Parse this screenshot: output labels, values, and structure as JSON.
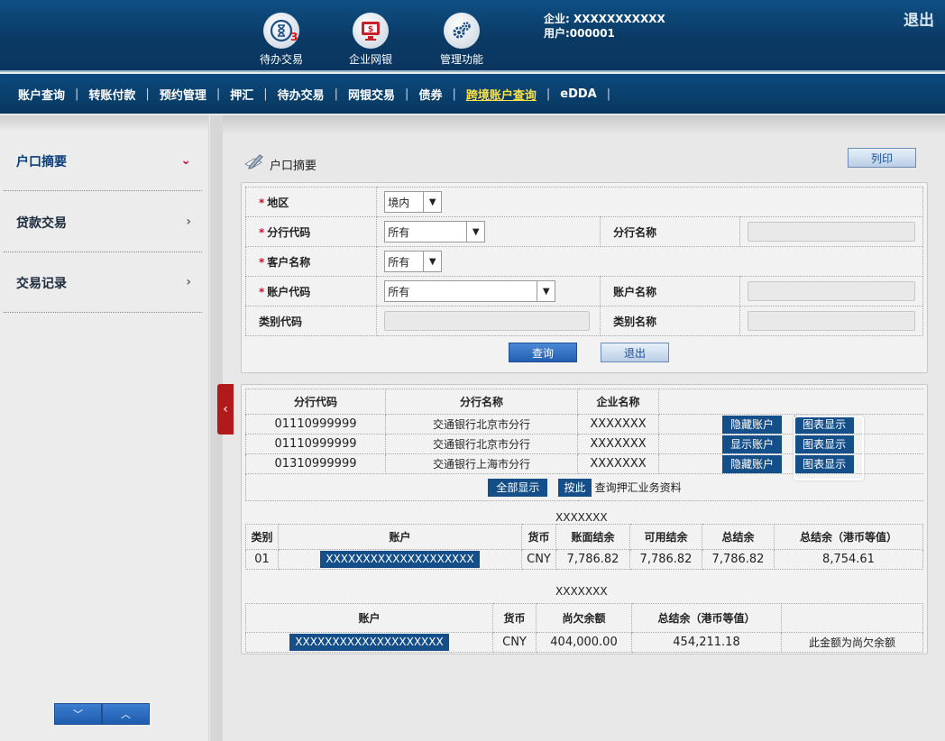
{
  "header": {
    "icons": [
      {
        "label": "待办交易",
        "icon": "hourglass-clock-icon",
        "badge": "3"
      },
      {
        "label": "企业网银",
        "icon": "monitor-dollar-icon"
      },
      {
        "label": "管理功能",
        "icon": "gears-icon"
      }
    ],
    "company": "企业: XXXXXXXXXXX",
    "user": "用户:000001",
    "logout": "退出"
  },
  "nav": {
    "items": [
      "账户查询",
      "转账付款",
      "预约管理",
      "押汇",
      "待办交易",
      "网银交易",
      "债券",
      "跨境账户查询",
      "eDDA"
    ],
    "active": "跨境账户查询",
    "separator": "|"
  },
  "sidebar": {
    "items": [
      {
        "label": "户口摘要",
        "chevron": "⌄"
      },
      {
        "label": "贷款交易",
        "chevron": "›"
      },
      {
        "label": "交易记录",
        "chevron": "›"
      }
    ]
  },
  "page": {
    "title": "户口摘要",
    "print": "列印"
  },
  "form": {
    "region_label": "地区",
    "region_value": "境内",
    "branch_code_label": "分行代码",
    "branch_code_value": "所有",
    "branch_name_label": "分行名称",
    "customer_label": "客户名称",
    "customer_value": "所有",
    "account_code_label": "账户代码",
    "account_code_value": "所有",
    "account_name_label": "账户名称",
    "category_code_label": "类别代码",
    "category_name_label": "类别名称",
    "required_mark": "*",
    "query": "查询",
    "exit": "退出"
  },
  "branches": {
    "headers": [
      "分行代码",
      "分行名称",
      "企业名称"
    ],
    "rows": [
      {
        "code": "01110999999",
        "name": "交通银行北京市分行",
        "company": "XXXXXXX",
        "toggle": "隐藏账户",
        "chart": "图表显示"
      },
      {
        "code": "01110999999",
        "name": "交通银行北京市分行",
        "company": "XXXXXXX",
        "toggle": "显示账户",
        "chart": "图表显示"
      },
      {
        "code": "01310999999",
        "name": "交通银行上海市分行",
        "company": "XXXXXXX",
        "toggle": "隐藏账户",
        "chart": "图表显示"
      }
    ],
    "show_all": "全部显示",
    "press": "按此",
    "press_note": "查询押汇业务资料"
  },
  "deposit": {
    "group": "XXXXXXX",
    "headers": [
      "类别",
      "账户",
      "货币",
      "账面结余",
      "可用结余",
      "总结余",
      "总结余（港币等值）"
    ],
    "row": {
      "category": "01",
      "account": "XXXXXXXXXXXXXXXXXXXX",
      "currency": "CNY",
      "book": "7,786.82",
      "available": "7,786.82",
      "total": "7,786.82",
      "hkd": "8,754.61"
    }
  },
  "loan": {
    "group": "XXXXXXX",
    "headers": [
      "账户",
      "货币",
      "尚欠余额",
      "总结余（港币等值）",
      ""
    ],
    "row": {
      "account": "XXXXXXXXXXXXXXXXXXXX",
      "currency": "CNY",
      "outstanding": "404,000.00",
      "hkd": "454,211.18",
      "note": "此金额为尚欠余额"
    }
  },
  "controls": {
    "down": "﹀",
    "up": "︿",
    "collapse": "‹"
  }
}
